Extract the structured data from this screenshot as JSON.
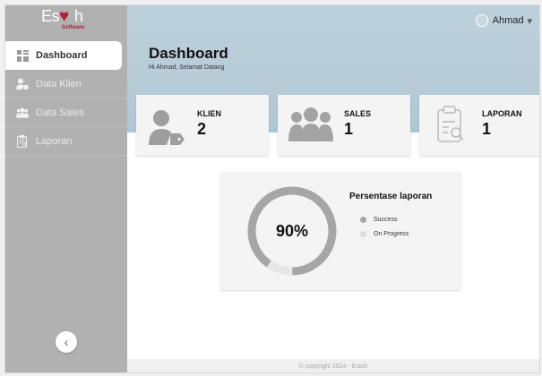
{
  "brand": {
    "logo_text_left": "Es",
    "logo_text_right": "h",
    "logo_sub": "Software"
  },
  "sidebar": {
    "items": [
      {
        "label": "Dashboard",
        "icon": "grid-icon",
        "active": true
      },
      {
        "label": "Data Klien",
        "icon": "user-tag-icon",
        "active": false
      },
      {
        "label": "Data Sales",
        "icon": "users-icon",
        "active": false
      },
      {
        "label": "Laporan",
        "icon": "report-icon",
        "active": false
      }
    ],
    "collapse_label": "‹"
  },
  "header": {
    "user_name": "Ahmad",
    "title": "Dashboard",
    "greeting": "Hi Ahmad, Selamat Datang"
  },
  "cards": [
    {
      "label": "KLIEN",
      "value": "2",
      "icon": "client-icon"
    },
    {
      "label": "SALES",
      "value": "1",
      "icon": "sales-icon"
    },
    {
      "label": "LAPORAN",
      "value": "1",
      "icon": "report-icon"
    }
  ],
  "report_chart": {
    "title": "Persentase laporan",
    "center_label": "90%",
    "legend": [
      {
        "label": "Success",
        "color": "#a6a6a6"
      },
      {
        "label": "On Progress",
        "color": "#dcdcdc"
      }
    ],
    "values": [
      90,
      10
    ]
  },
  "footer": {
    "text": "© copyright 2024 - Estoh"
  },
  "colors": {
    "sidebar_bg": "#b1b1b1",
    "header_band": "#bdd1dd",
    "brand_red": "#b2203a"
  }
}
